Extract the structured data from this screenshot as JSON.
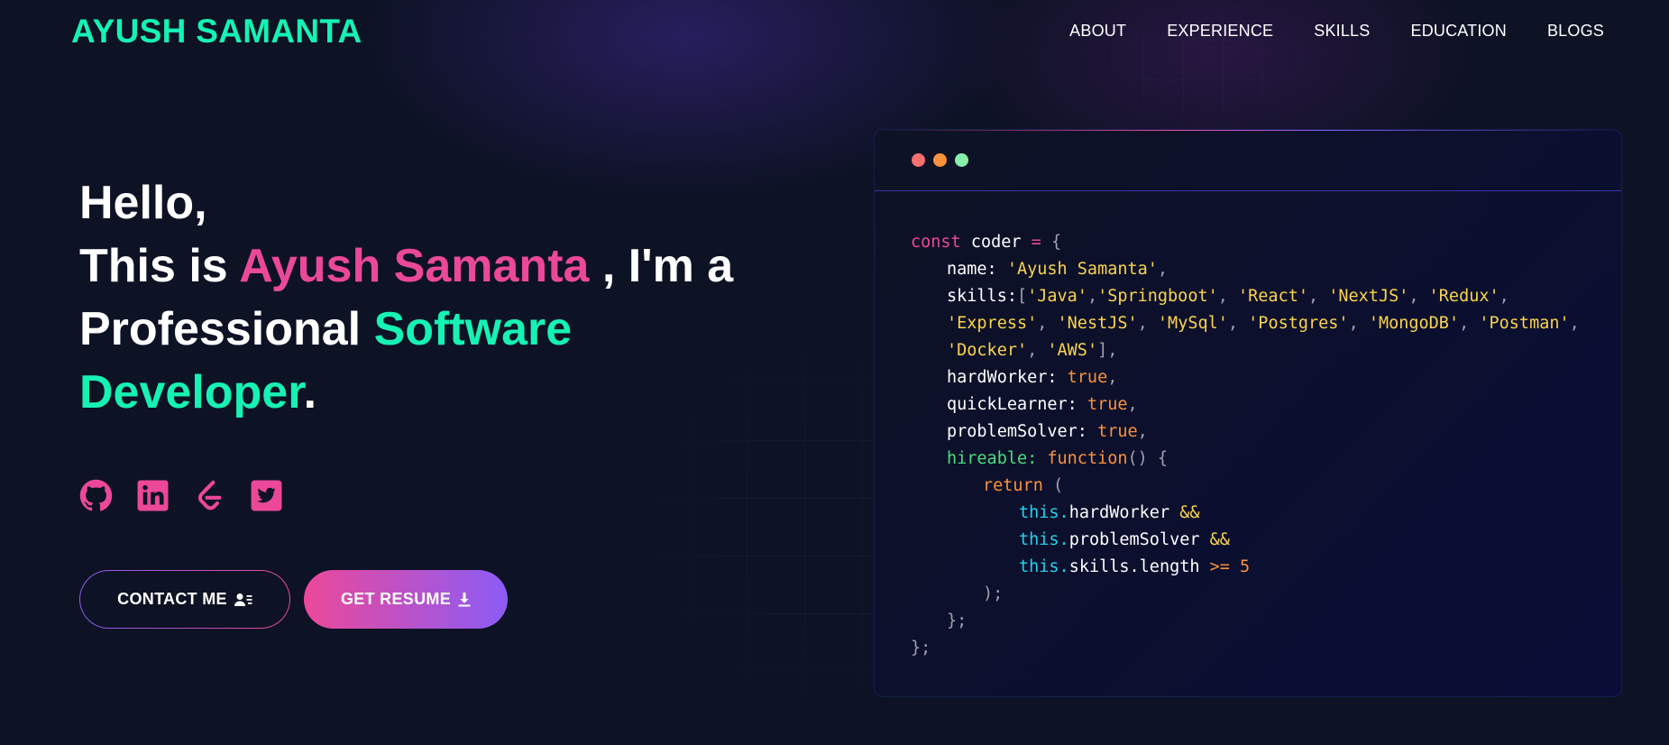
{
  "brand": "AYUSH SAMANTA",
  "nav": [
    "ABOUT",
    "EXPERIENCE",
    "SKILLS",
    "EDUCATION",
    "BLOGS"
  ],
  "hero": {
    "line1": "Hello,",
    "this_is": "This is ",
    "name": "Ayush Samanta",
    "im_a": " , I'm a",
    "professional": "Professional ",
    "software": "Software",
    "developer": "Developer",
    "period": "."
  },
  "socials": [
    "github-icon",
    "linkedin-icon",
    "leetcode-icon",
    "twitter-icon"
  ],
  "buttons": {
    "contact": "CONTACT ME",
    "resume": "GET RESUME"
  },
  "code": {
    "const_kw": "const",
    "var": " coder ",
    "eq": "=",
    "open": " {",
    "name_key": "name: ",
    "name_val": "'Ayush Samanta'",
    "skills_key": "skills:",
    "skills_line1": [
      "'Java'",
      "'Springboot'",
      "'React'",
      "'NextJS'",
      "'Redux'"
    ],
    "skills_line2": [
      "'Express'",
      "'NestJS'",
      "'MySql'",
      "'Postgres'",
      "'MongoDB'",
      "'Postman'"
    ],
    "skills_line3": [
      "'Docker'",
      "'AWS'"
    ],
    "hardWorker": "hardWorker: ",
    "quickLearner": "quickLearner: ",
    "problemSolver": "problemSolver: ",
    "true": "true",
    "hireable": "hireable:",
    "function": " function",
    "fn_tail": "() {",
    "return": "return",
    "ret_open": " (",
    "this": "this.",
    "hw": "hardWorker ",
    "ps": "problemSolver ",
    "and": "&&",
    "len": "skills.length ",
    "gte": ">= 5",
    "ret_close": ");",
    "fn_close": "};",
    "obj_close": "};"
  },
  "colors": {
    "accent_teal": "#16f2b3",
    "accent_pink": "#ec4899",
    "accent_purple": "#8b5cf6",
    "background": "#0d1224"
  }
}
